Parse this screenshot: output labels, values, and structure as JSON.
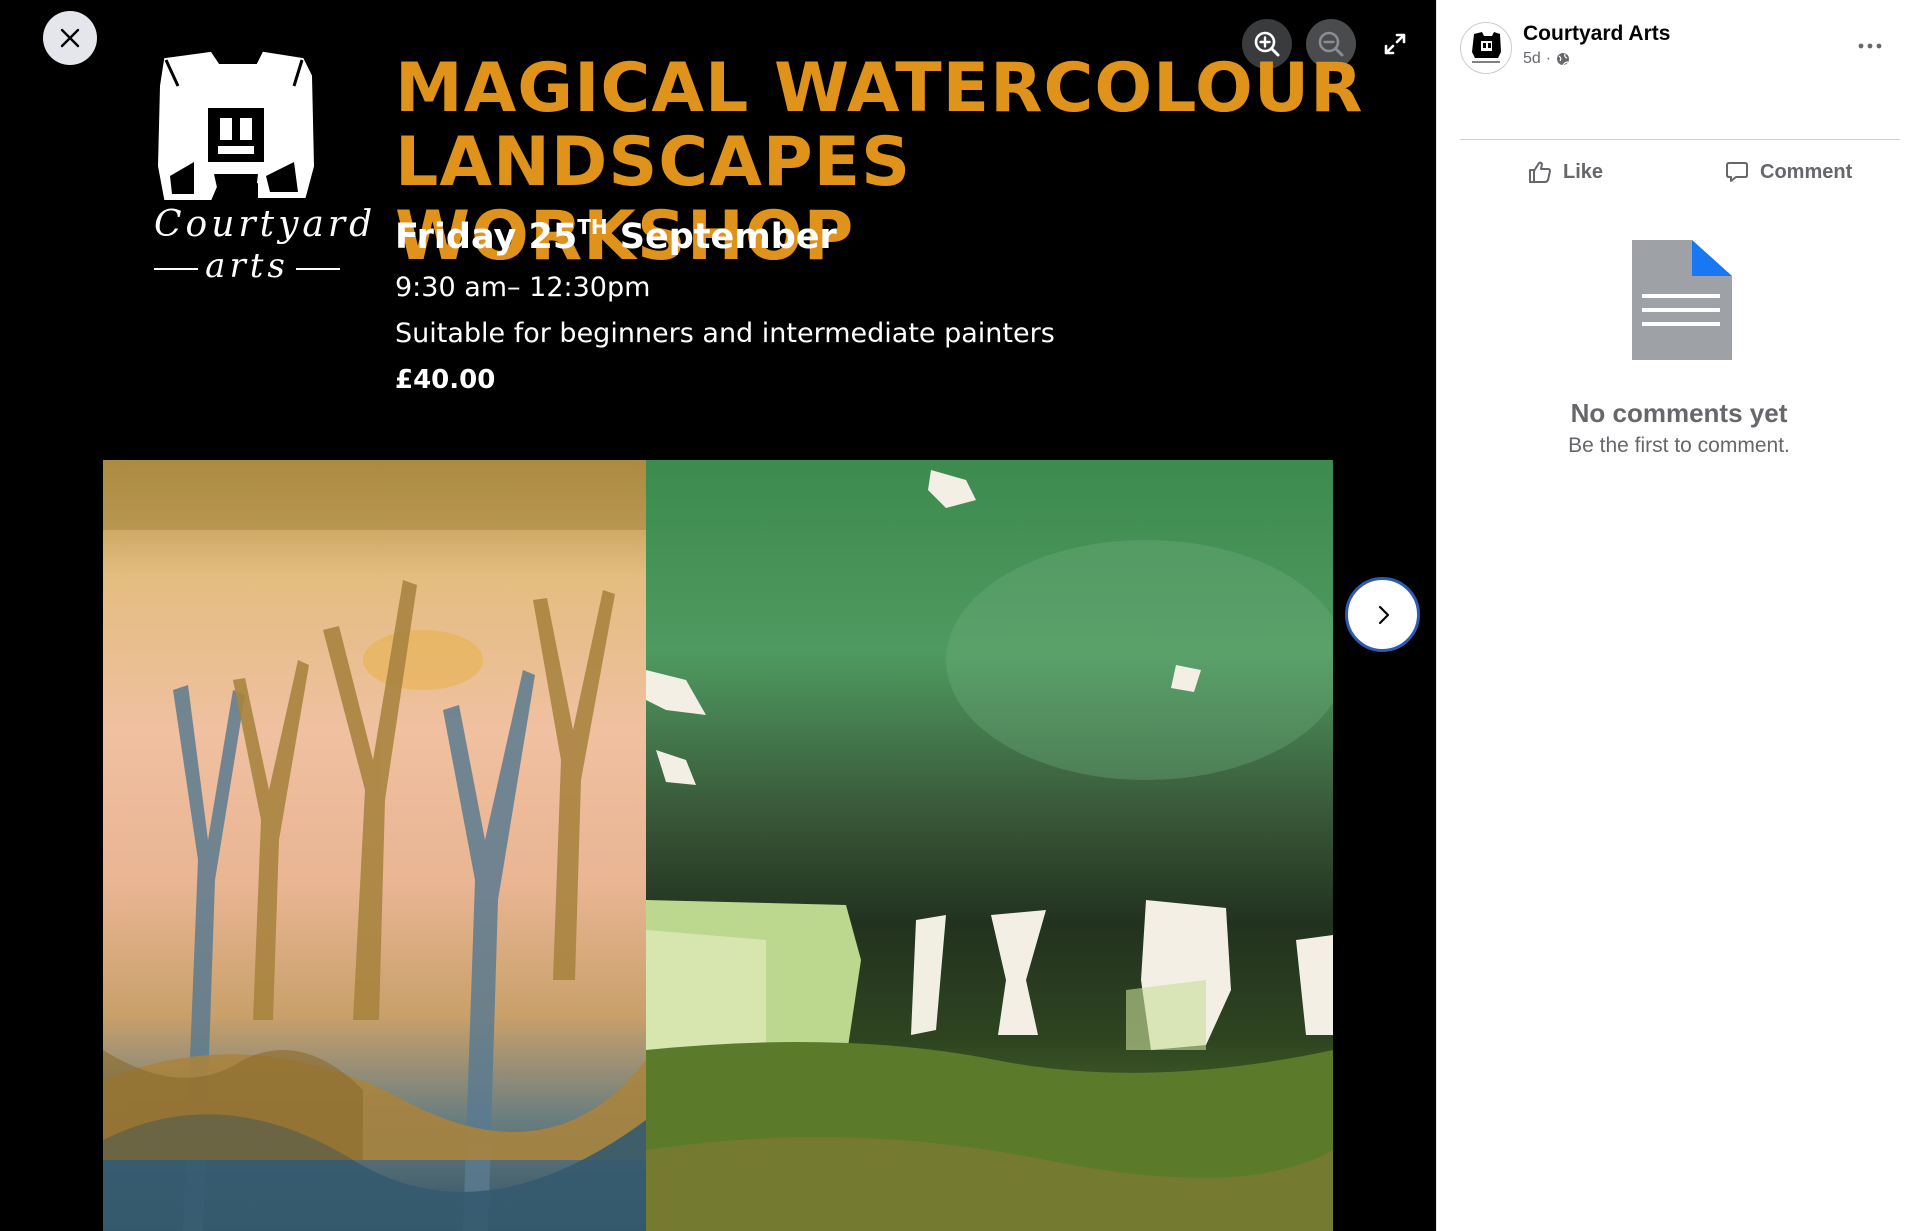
{
  "viewer": {
    "poster": {
      "logo_line1": "Courtyard",
      "logo_line2": "arts",
      "title_line1": "MAGICAL WATERCOLOUR",
      "title_line2": "LANDSCAPES WORKSHOP",
      "date_day": "Friday 25",
      "date_suffix": "TH",
      "date_month": " September",
      "time": "9:30 am– 12:30pm",
      "suitable": "Suitable for beginners and intermediate painters",
      "price": "£40.00"
    },
    "controls": {
      "close_icon": "close-icon",
      "zoom_in_icon": "zoom-in-icon",
      "zoom_out_icon": "zoom-out-icon",
      "fullscreen_icon": "fullscreen-icon",
      "next_icon": "chevron-right-icon"
    }
  },
  "panel": {
    "page_name": "Courtyard Arts",
    "time_ago": "5d",
    "separator": "·",
    "privacy_icon": "globe-icon",
    "more_icon": "more-icon",
    "actions": {
      "like": "Like",
      "comment": "Comment"
    },
    "empty_state": {
      "title": "No comments yet",
      "subtitle": "Be the first to comment."
    }
  },
  "colors": {
    "title_accent": "#e0931a",
    "next_button_ring": "#2d5ab5",
    "doc_icon_corner": "#1877f2"
  }
}
